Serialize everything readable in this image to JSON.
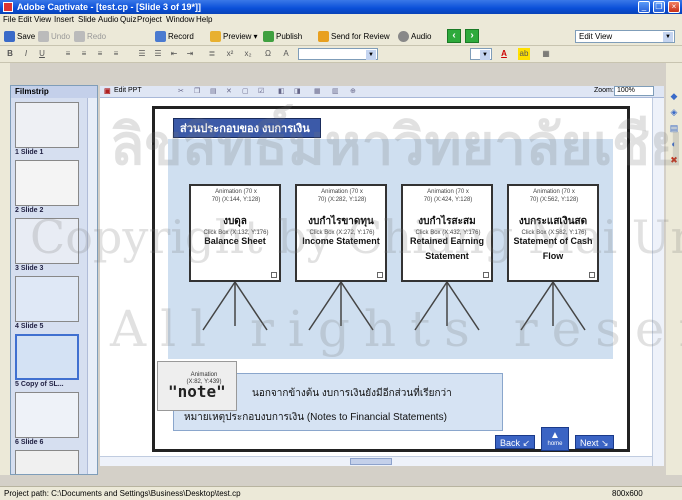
{
  "window": {
    "title": "Adobe Captivate - [test.cp - [Slide 3 of 19*]]"
  },
  "menu": [
    "File",
    "Edit",
    "View",
    "Insert",
    "Slide",
    "Audio",
    "Quiz",
    "Project",
    "Window",
    "Help"
  ],
  "toolbar": {
    "save": "Save",
    "undo": "Undo",
    "redo": "Redo",
    "record": "Record",
    "preview": "Preview",
    "publish": "Publish",
    "send_for_review": "Send for Review",
    "audio": "Audio",
    "view_mode": "Edit View"
  },
  "edit_toolbar": {
    "edit_ppt": "Edit PPT",
    "zoom_label": "Zoom:",
    "zoom_value": "100%"
  },
  "filmstrip": {
    "header": "Filmstrip",
    "slides": [
      {
        "label": "1 Slide 1"
      },
      {
        "label": "2 Slide 2"
      },
      {
        "label": "3 Slide 3"
      },
      {
        "label": "4 Slide 5"
      },
      {
        "label": "5 Copy of SL..."
      },
      {
        "label": "6 Slide 6"
      }
    ]
  },
  "slide": {
    "title": "ส่วนประกอบของ งบการเงิน",
    "easels": [
      {
        "th": "งบดุล",
        "en": "Balance Sheet",
        "anim": "Animation (70 x 70) (X:144, Y:128)",
        "click": "Click Box (X:132, Y:176)"
      },
      {
        "th": "งบกำไรขาดทุน",
        "en": "Income Statement",
        "anim": "Animation (70 x 70) (X:282, Y:128)",
        "click": "Click Box (X:272, Y:176)"
      },
      {
        "th": "งบกำไรสะสม",
        "en": "Retained Earning Statement",
        "anim": "Animation (70 x 70) (X:424, Y:128)",
        "click": "Click Box (X:432, Y:176)"
      },
      {
        "th": "งบกระแสเงินสด",
        "en": "Statement of Cash Flow",
        "anim": "Animation (70 x 70) (X:562, Y:128)",
        "click": "Click Box (X:582, Y:176)"
      }
    ],
    "note_word": "\"note\"",
    "note_anim": "Animation (X:82, Y:439)",
    "paragraph_line1": "นอกจากข้างต้น งบการเงินยังมีอีกส่วนที่เรียกว่า",
    "paragraph_line2": "หมายเหตุประกอบงบการเงิน (Notes to Financial Statements)",
    "back": "Back",
    "home": "home",
    "next": "Next"
  },
  "status": {
    "path": "Project path: C:\\Documents and Settings\\Business\\Desktop\\test.cp",
    "resolution": "800x600"
  },
  "watermark": {
    "line1": "ลิขสิทธิ์มหาวิทยาลัยเชียงใหม่",
    "line2": "Copyright by Chiang Mai University",
    "line3": "All rights reserved"
  },
  "colors": {
    "title_bar": "#0a4fd8",
    "slide_title_bg": "#3c5aa8",
    "slide_panel_bg": "#cfdff0",
    "nav_button": "#3b64c4"
  }
}
